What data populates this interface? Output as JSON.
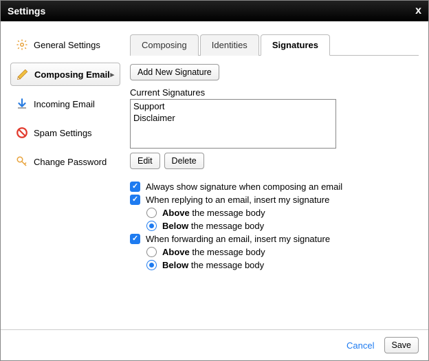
{
  "title": "Settings",
  "sidebar": {
    "items": [
      {
        "label": "General Settings"
      },
      {
        "label": "Composing Email"
      },
      {
        "label": "Incoming Email"
      },
      {
        "label": "Spam Settings"
      },
      {
        "label": "Change Password"
      }
    ]
  },
  "tabs": [
    {
      "label": "Composing"
    },
    {
      "label": "Identities"
    },
    {
      "label": "Signatures"
    }
  ],
  "buttons": {
    "add_signature": "Add New Signature",
    "edit": "Edit",
    "delete": "Delete",
    "cancel": "Cancel",
    "save": "Save"
  },
  "labels": {
    "current_signatures": "Current Signatures"
  },
  "signatures": [
    "Support",
    "Disclaimer"
  ],
  "options": {
    "always_show": {
      "label": "Always show signature when composing an email",
      "checked": true
    },
    "reply_insert": {
      "label": "When replying to an email, insert my signature",
      "checked": true
    },
    "reply_above_bold": "Above",
    "reply_above_rest": " the message body",
    "reply_below_bold": "Below",
    "reply_below_rest": " the message body",
    "forward_insert": {
      "label": "When forwarding an email, insert my signature",
      "checked": true
    },
    "forward_above_bold": "Above",
    "forward_above_rest": " the message body",
    "forward_below_bold": "Below",
    "forward_below_rest": " the message body"
  }
}
